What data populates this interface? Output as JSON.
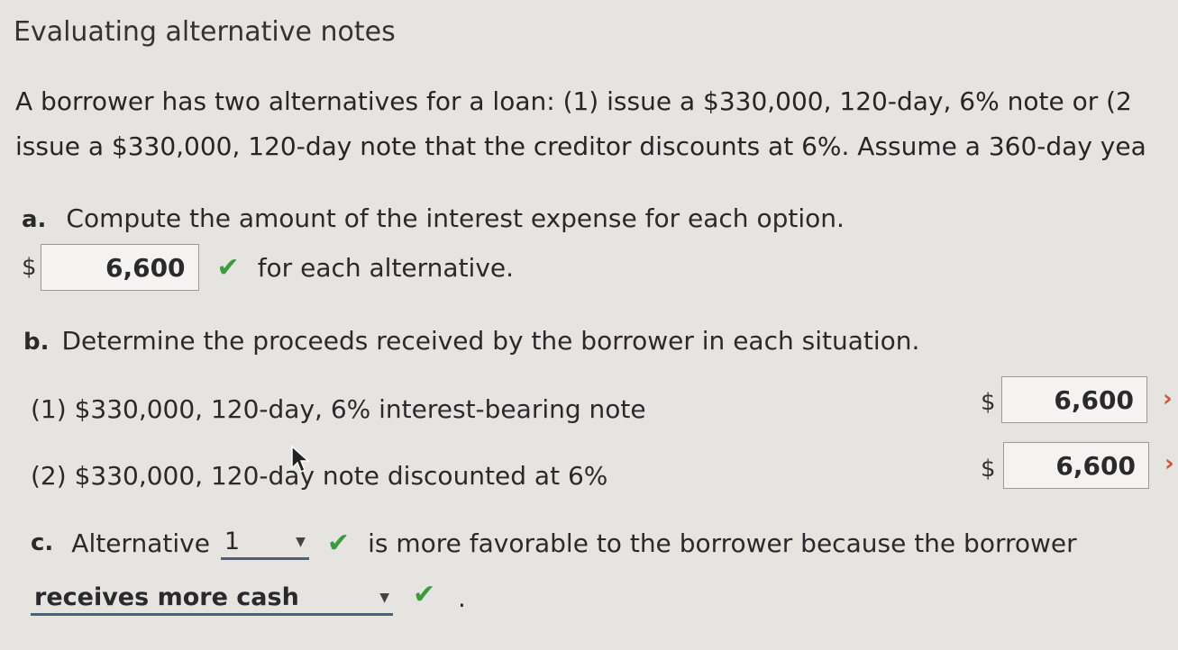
{
  "title": "Evaluating alternative notes",
  "intro": {
    "line1": "A borrower has two alternatives for a loan: (1) issue a $330,000, 120-day, 6% note or (2",
    "line2": "issue a $330,000, 120-day note that the creditor discounts at 6%. Assume a 360-day yea"
  },
  "part_a": {
    "letter": "a.",
    "question": "Compute the amount of the interest expense for each option.",
    "currency": "$",
    "answer": "6,600",
    "answer_status": "correct",
    "suffix": "for each alternative."
  },
  "part_b": {
    "letter": "b.",
    "question": "Determine the proceeds received by the borrower in each situation.",
    "rows": [
      {
        "label": "(1) $330,000, 120-day, 6% interest-bearing note",
        "currency": "$",
        "answer": "6,600",
        "status": "incorrect"
      },
      {
        "label": "(2) $330,000, 120-day note discounted at 6%",
        "currency": "$",
        "answer": "6,600",
        "status": "incorrect"
      }
    ]
  },
  "part_c": {
    "letter": "c.",
    "prefix": "Alternative",
    "selected_alternative": "1",
    "alternative_status": "correct",
    "middle": "is more favorable to the borrower because the borrower",
    "selected_reason": "receives more cash",
    "reason_status": "correct",
    "end": "."
  },
  "icons": {
    "correct": "check-icon",
    "incorrect": "x-mark-icon",
    "dropdown": "chevron-down-icon"
  },
  "colors": {
    "background": "#e6e4e1",
    "correct": "#3c9b3c",
    "incorrect": "#d2553a",
    "select_underline": "#4a6080"
  }
}
